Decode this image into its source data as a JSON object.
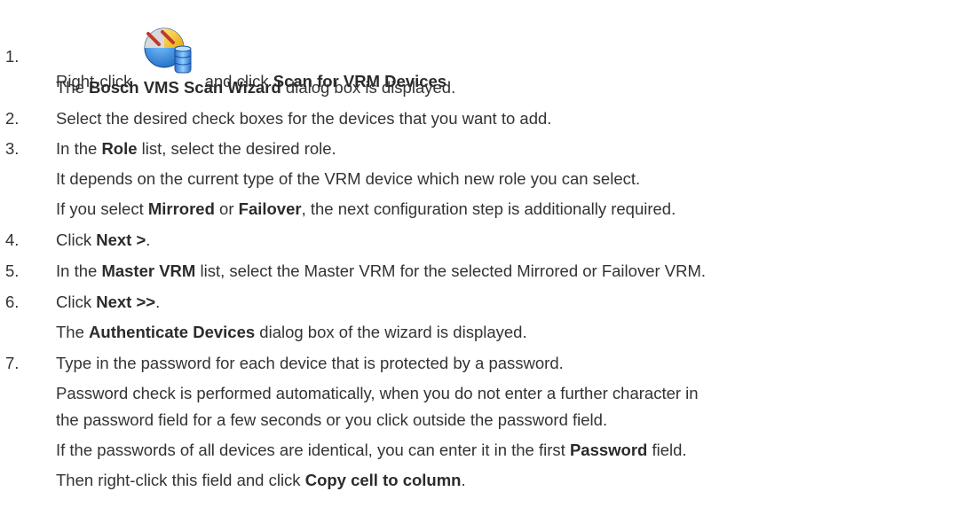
{
  "steps": [
    {
      "number": "1.",
      "lines": [
        {
          "parts": [
            {
              "t": "Right-click "
            },
            {
              "icon": "vrm-device-icon"
            },
            {
              "t": " and click "
            },
            {
              "b": "Scan for VRM Devices"
            },
            {
              "t": "."
            }
          ]
        },
        {
          "parts": [
            {
              "t": "The "
            },
            {
              "b": "Bosch VMS Scan Wizard"
            },
            {
              "t": " dialog box is displayed."
            }
          ]
        }
      ]
    },
    {
      "number": "2.",
      "lines": [
        {
          "parts": [
            {
              "t": "Select the desired check boxes for the devices that you want to add."
            }
          ]
        }
      ]
    },
    {
      "number": "3.",
      "lines": [
        {
          "parts": [
            {
              "t": "In the "
            },
            {
              "b": "Role"
            },
            {
              "t": " list, select the desired role."
            }
          ]
        },
        {
          "parts": [
            {
              "t": "It depends on the current type of the VRM device which new role you can select."
            }
          ]
        },
        {
          "parts": [
            {
              "t": "If you select "
            },
            {
              "b": "Mirrored"
            },
            {
              "t": " or "
            },
            {
              "b": "Failover"
            },
            {
              "t": ", the next configuration step is additionally required."
            }
          ]
        }
      ]
    },
    {
      "number": "4.",
      "lines": [
        {
          "parts": [
            {
              "t": "Click "
            },
            {
              "b": "Next >"
            },
            {
              "t": "."
            }
          ]
        }
      ]
    },
    {
      "number": "5.",
      "lines": [
        {
          "parts": [
            {
              "t": "In the "
            },
            {
              "b": "Master VRM"
            },
            {
              "t": " list, select the Master VRM for the selected Mirrored or Failover VRM."
            }
          ]
        }
      ]
    },
    {
      "number": "6.",
      "lines": [
        {
          "parts": [
            {
              "t": "Click "
            },
            {
              "b": "Next >>"
            },
            {
              "t": "."
            }
          ]
        },
        {
          "parts": [
            {
              "t": "The "
            },
            {
              "b": "Authenticate Devices"
            },
            {
              "t": " dialog box of the wizard is displayed."
            }
          ]
        }
      ]
    },
    {
      "number": "7.",
      "lines": [
        {
          "parts": [
            {
              "t": "Type in the password for each device that is protected by a password."
            }
          ]
        },
        {
          "parts": [
            {
              "t": "Password check is performed automatically, when you do not enter a further character in"
            }
          ]
        },
        {
          "parts": [
            {
              "t": "the password field for a few seconds or you click outside the password field."
            }
          ]
        },
        {
          "parts": [
            {
              "t": "If the passwords of all devices are identical, you can enter it in the first "
            },
            {
              "b": "Password"
            },
            {
              "t": " field."
            }
          ]
        },
        {
          "parts": [
            {
              "t": "Then right-click this field and click "
            },
            {
              "b": "Copy cell to column"
            },
            {
              "t": "."
            }
          ]
        }
      ]
    }
  ]
}
